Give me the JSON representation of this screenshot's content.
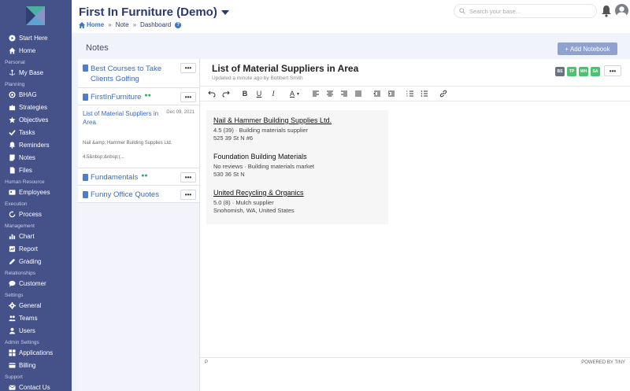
{
  "app": {
    "title": "First In Furniture (Demo)",
    "breadcrumb": [
      "Home",
      "Note",
      "Dashboard"
    ],
    "search_placeholder": "Search your base..."
  },
  "sidebar": {
    "items": [
      {
        "type": "item",
        "label": "Start Here",
        "icon": "play-circle-icon"
      },
      {
        "type": "item",
        "label": "Home",
        "icon": "home-icon"
      },
      {
        "type": "section",
        "label": "Personal"
      },
      {
        "type": "item",
        "label": "My Base",
        "icon": "anchor-icon"
      },
      {
        "type": "section",
        "label": "Planning"
      },
      {
        "type": "item",
        "label": "BHAG",
        "icon": "target-icon"
      },
      {
        "type": "item",
        "label": "Strategies",
        "icon": "puzzle-icon"
      },
      {
        "type": "item",
        "label": "Objectives",
        "icon": "star-icon"
      },
      {
        "type": "item",
        "label": "Tasks",
        "icon": "check-icon"
      },
      {
        "type": "item",
        "label": "Reminders",
        "icon": "bell-icon"
      },
      {
        "type": "item",
        "label": "Notes",
        "icon": "note-icon"
      },
      {
        "type": "item",
        "label": "Files",
        "icon": "file-icon"
      },
      {
        "type": "section",
        "label": "Human Resource"
      },
      {
        "type": "item",
        "label": "Employees",
        "icon": "id-card-icon"
      },
      {
        "type": "section",
        "label": "Execution"
      },
      {
        "type": "item",
        "label": "Process",
        "icon": "refresh-icon"
      },
      {
        "type": "section",
        "label": "Management"
      },
      {
        "type": "item",
        "label": "Chart",
        "icon": "chart-icon"
      },
      {
        "type": "item",
        "label": "Report",
        "icon": "report-icon"
      },
      {
        "type": "item",
        "label": "Grading",
        "icon": "pencil-icon"
      },
      {
        "type": "section",
        "label": "Relationships"
      },
      {
        "type": "item",
        "label": "Customer",
        "icon": "chat-icon"
      },
      {
        "type": "section",
        "label": "Settings"
      },
      {
        "type": "item",
        "label": "General",
        "icon": "gear-icon"
      },
      {
        "type": "item",
        "label": "Teams",
        "icon": "users-icon"
      },
      {
        "type": "item",
        "label": "Users",
        "icon": "user-icon"
      },
      {
        "type": "section",
        "label": "Admin Settings"
      },
      {
        "type": "item",
        "label": "Applications",
        "icon": "grid-icon"
      },
      {
        "type": "item",
        "label": "Billing",
        "icon": "card-icon"
      },
      {
        "type": "section",
        "label": "Support"
      },
      {
        "type": "item",
        "label": "Contact Us",
        "icon": "mail-icon"
      }
    ]
  },
  "notes_page": {
    "title": "Notes",
    "add_button": "+ Add Notebook",
    "notebooks": [
      {
        "name": "Best Courses to Take Clients Golfing",
        "shared": false
      },
      {
        "name": "FirstInFurniture",
        "shared": true
      },
      {
        "name": "Fundamentals",
        "shared": true
      },
      {
        "name": "Funny Office Quotes",
        "shared": false
      }
    ],
    "active_note": {
      "title": "List of Material Suppliers in Area",
      "date": "Dec 09, 2021",
      "preview_1": "Nail &amp; Hammer Building Supplies Ltd.",
      "preview_2": "4.5&nbsp;&nbsp;(..."
    },
    "menu_glyph": "•••"
  },
  "editor": {
    "title": "List of Material Suppliers in Area",
    "meta": "Updated a minute ago by Bobbert Smith",
    "collaborators": [
      {
        "initials": "BS",
        "color": "#6b7280"
      },
      {
        "initials": "TP",
        "color": "#4cc36f"
      },
      {
        "initials": "WH",
        "color": "#4cc36f"
      },
      {
        "initials": "SA",
        "color": "#4cc36f"
      }
    ],
    "suppliers": [
      {
        "name": "Nail & Hammer Building Supplies Ltd.",
        "linked": true,
        "line1": "4.5  (39) · Building materials supplier",
        "line2": "525 39 St N #6"
      },
      {
        "name": "Foundation Building Materials",
        "linked": false,
        "line1": "No reviews · Building materials market",
        "line2": "530 36 St N"
      },
      {
        "name": "United Recycling & Organics",
        "linked": true,
        "line1": "5.0  (8) · Mulch supplier",
        "line2": "Snohomish, WA, United States"
      }
    ],
    "status_left": "P",
    "status_right": "POWERED BY TINY"
  }
}
